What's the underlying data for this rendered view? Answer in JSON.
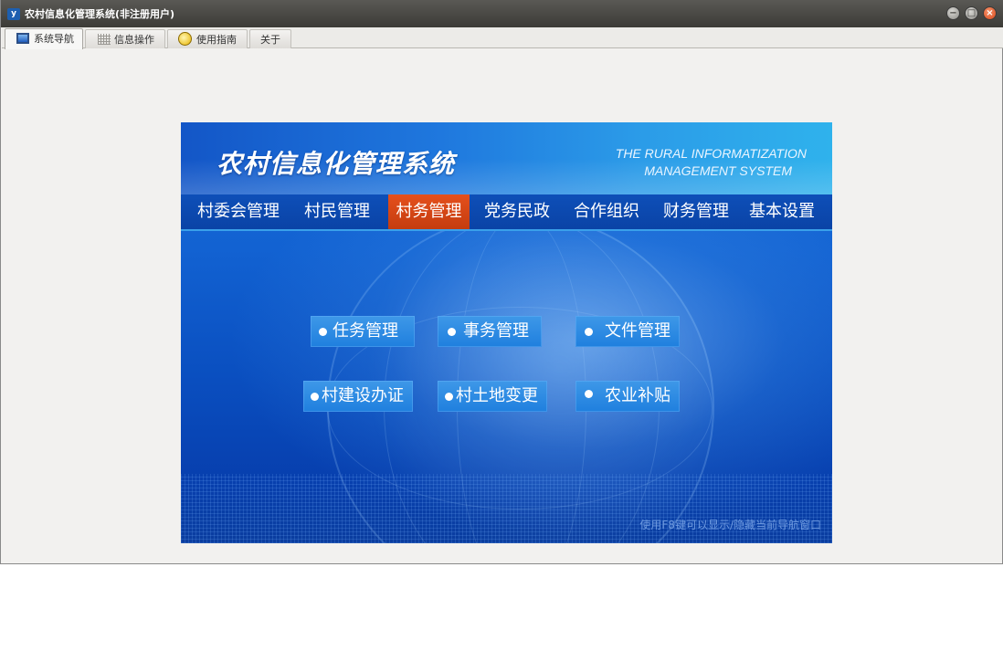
{
  "window": {
    "title": "农村信息化管理系统(非注册用户)",
    "app_icon_text": "y"
  },
  "titlebar_buttons": {
    "minimize": "−",
    "maximize": "□",
    "close": "×"
  },
  "tabs": [
    {
      "label": "系统导航",
      "icon": "monitor-icon",
      "active": true
    },
    {
      "label": "信息操作",
      "icon": "grid-icon",
      "active": false
    },
    {
      "label": "使用指南",
      "icon": "help-icon",
      "active": false
    },
    {
      "label": "关于",
      "icon": "",
      "active": false
    }
  ],
  "banner": {
    "title": "农村信息化管理系统",
    "subtitle_line1": "THE RURAL INFORMATIZATION",
    "subtitle_line2": "MANAGEMENT SYSTEM",
    "hint": "使用F8键可以显示/隐藏当前导航窗口"
  },
  "nav": [
    {
      "label": "村委会管理",
      "active": false
    },
    {
      "label": "村民管理",
      "active": false
    },
    {
      "label": "村务管理",
      "active": true
    },
    {
      "label": "党务民政",
      "active": false
    },
    {
      "label": "合作组织",
      "active": false
    },
    {
      "label": "财务管理",
      "active": false
    },
    {
      "label": "基本设置",
      "active": false
    }
  ],
  "functions": [
    {
      "label": "任务管理"
    },
    {
      "label": "事务管理"
    },
    {
      "label": "文件管理"
    },
    {
      "label": "村建设办证"
    },
    {
      "label": "村土地变更"
    },
    {
      "label": "农业补贴"
    }
  ],
  "colors": {
    "nav_active": "#d4461a",
    "banner_blue": "#1262d2",
    "titlebar": "#3c3b37"
  }
}
